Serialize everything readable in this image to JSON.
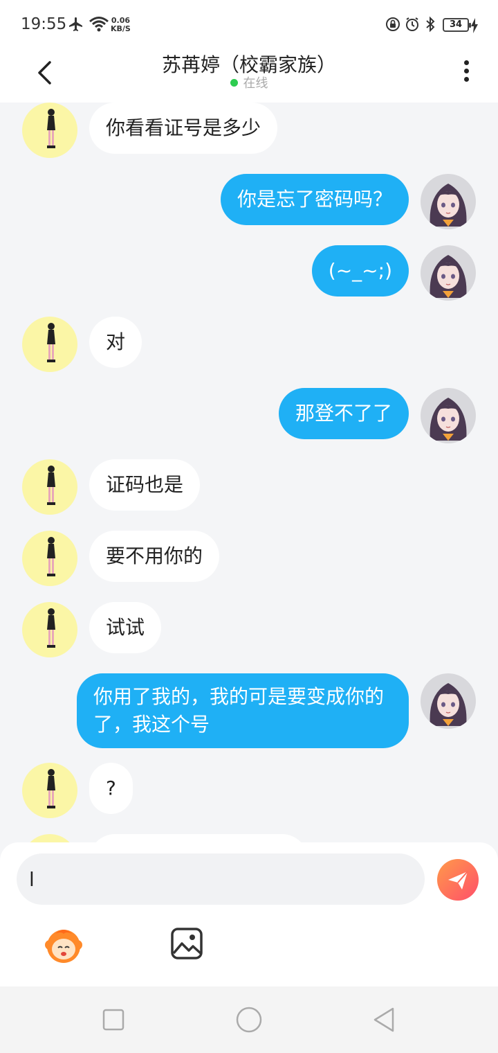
{
  "status_bar": {
    "time": "19:55",
    "net_speed_value": "0.06",
    "net_speed_unit": "KB/S",
    "battery": "34",
    "icons": [
      "airplane-icon",
      "wifi-icon",
      "rotation-lock-icon",
      "alarm-icon",
      "bluetooth-icon",
      "battery-icon",
      "charging-icon"
    ]
  },
  "header": {
    "title": "苏苒婷（校霸家族）",
    "status": "在线",
    "status_color": "#2dcc50"
  },
  "colors": {
    "my_bubble": "#1fb0f5",
    "their_bubble": "#ffffff",
    "background": "#f4f5f7"
  },
  "messages": [
    {
      "sender": "them",
      "text": "你看看证号是多少"
    },
    {
      "sender": "me",
      "text": "你是忘了密码吗？"
    },
    {
      "sender": "me",
      "text": "(~_~;)"
    },
    {
      "sender": "them",
      "text": "对"
    },
    {
      "sender": "me",
      "text": "那登不了了"
    },
    {
      "sender": "them",
      "text": "证码也是"
    },
    {
      "sender": "them",
      "text": "要不用你的"
    },
    {
      "sender": "them",
      "text": "试试"
    },
    {
      "sender": "me",
      "text": "你用了我的，我的可是要变成你的了，我这个号"
    },
    {
      "sender": "them",
      "text": "?"
    }
  ],
  "composer": {
    "input_value": "l",
    "icons": [
      "send-icon",
      "sticker-icon",
      "image-icon"
    ]
  },
  "nav_bar": {
    "icons": [
      "recents-icon",
      "home-icon",
      "back-icon"
    ]
  }
}
